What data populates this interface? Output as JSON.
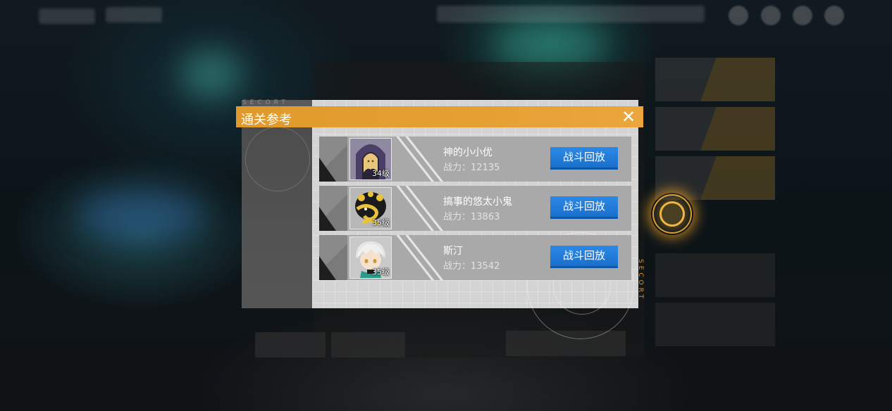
{
  "dialog": {
    "title": "通关参考",
    "close_icon": "close-x-icon",
    "decor_text": "SECORT",
    "accent_color": "#e4a033",
    "button_color": "#1f7bd8"
  },
  "entries": [
    {
      "name": "神的小小优",
      "power": "战力：12135",
      "level": "34级",
      "button": "战斗回放",
      "avatar": "hooded-character-avatar"
    },
    {
      "name": "搞事的悠太小鬼",
      "power": "战力：13863",
      "level": "35级",
      "button": "战斗回放",
      "avatar": "yellow-spiral-creature-avatar"
    },
    {
      "name": "斯汀",
      "power": "战力：13542",
      "level": "35级",
      "button": "战斗回放",
      "avatar": "white-hair-boy-avatar"
    }
  ]
}
